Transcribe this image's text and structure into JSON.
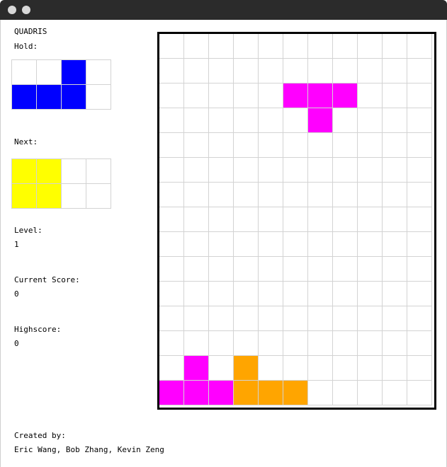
{
  "title": "QUADRIS",
  "hold": {
    "label": "Hold:",
    "cells": [
      [
        null,
        null,
        "#0000ff",
        null
      ],
      [
        "#0000ff",
        "#0000ff",
        "#0000ff",
        null
      ]
    ]
  },
  "next": {
    "label": "Next:",
    "cells": [
      [
        "#ffff00",
        "#ffff00",
        null,
        null
      ],
      [
        "#ffff00",
        "#ffff00",
        null,
        null
      ]
    ]
  },
  "level": {
    "label": "Level:",
    "value": "1"
  },
  "current_score": {
    "label": "Current Score:",
    "value": "0"
  },
  "highscore": {
    "label": "Highscore:",
    "value": "0"
  },
  "credits": {
    "label": "Created by:",
    "names": "Eric Wang, Bob Zhang, Kevin Zeng"
  },
  "colors": {
    "T": "#ff00ff",
    "L": "#ffa500",
    "J": "#0000ff",
    "O": "#ffff00",
    "grid": "#d3d3d3"
  },
  "board": {
    "cols": 11,
    "rows": 15,
    "filled": [
      {
        "row": 2,
        "col": 5,
        "color": "#ff00ff"
      },
      {
        "row": 2,
        "col": 6,
        "color": "#ff00ff"
      },
      {
        "row": 2,
        "col": 7,
        "color": "#ff00ff"
      },
      {
        "row": 3,
        "col": 6,
        "color": "#ff00ff"
      },
      {
        "row": 13,
        "col": 1,
        "color": "#ff00ff"
      },
      {
        "row": 14,
        "col": 0,
        "color": "#ff00ff"
      },
      {
        "row": 14,
        "col": 1,
        "color": "#ff00ff"
      },
      {
        "row": 14,
        "col": 2,
        "color": "#ff00ff"
      },
      {
        "row": 13,
        "col": 3,
        "color": "#ffa500"
      },
      {
        "row": 14,
        "col": 3,
        "color": "#ffa500"
      },
      {
        "row": 14,
        "col": 4,
        "color": "#ffa500"
      },
      {
        "row": 14,
        "col": 5,
        "color": "#ffa500"
      }
    ]
  }
}
